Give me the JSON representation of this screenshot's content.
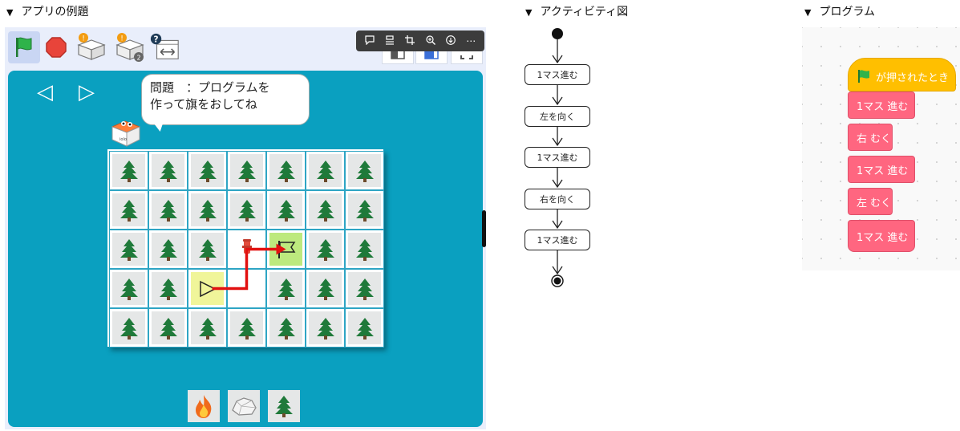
{
  "headings": {
    "app": "アプリの例題",
    "activity": "アクティビティ図",
    "program": "プログラム",
    "marker": "▼"
  },
  "toolbar": {
    "buttons": [
      {
        "name": "green-flag",
        "color": "#2fb34a"
      },
      {
        "name": "stop",
        "color": "#e8443a"
      },
      {
        "name": "add-tile",
        "badge": "!"
      },
      {
        "name": "add-tile-2",
        "badge": "!",
        "count": "2"
      },
      {
        "name": "help-swap"
      }
    ],
    "overlay_icons": [
      "comment-icon",
      "align-icon",
      "crop-icon",
      "zoom-in-icon",
      "download-icon",
      "more-icon"
    ],
    "more_label": "⋯"
  },
  "stage": {
    "background": "#0aa0c0",
    "nav_prev": "◁",
    "nav_next": "▷",
    "bubble_line1": "問題　：プログラムを",
    "bubble_line2": "作って旗をおしてね",
    "robot_label": "iolo",
    "grid": {
      "rows": 5,
      "cols": 7,
      "cells": [
        [
          "tree",
          "tree",
          "tree",
          "tree",
          "tree",
          "tree",
          "tree"
        ],
        [
          "tree",
          "tree",
          "tree",
          "tree",
          "tree",
          "tree",
          "tree"
        ],
        [
          "tree",
          "tree",
          "tree",
          "fire-hydrant",
          "goal",
          "tree",
          "tree"
        ],
        [
          "tree",
          "tree",
          "start",
          "empty",
          "tree",
          "tree",
          "tree"
        ],
        [
          "tree",
          "tree",
          "tree",
          "tree",
          "tree",
          "tree",
          "tree"
        ]
      ]
    },
    "path_color": "#e21010",
    "palette": [
      "fire-icon",
      "rock-icon",
      "tree-icon"
    ]
  },
  "activity": {
    "nodes": [
      "1マス進む",
      "左を向く",
      "1マス進む",
      "右を向く",
      "1マス進む"
    ]
  },
  "program": {
    "hat_label": "が押されたとき",
    "blocks": [
      {
        "label": "1マス 進む"
      },
      {
        "label": "右 むく"
      },
      {
        "label": "1マス 進む"
      },
      {
        "label": "左 むく"
      },
      {
        "label": "1マス 進む"
      }
    ],
    "hat_color": "#ffbf00",
    "block_color": "#ff6680"
  }
}
